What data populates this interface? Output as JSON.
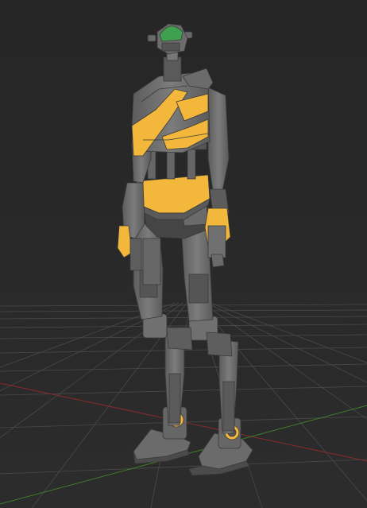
{
  "viewport": {
    "name": "3d-viewport",
    "background": "#282828"
  },
  "scene": {
    "model": "humanoid-robot",
    "colors": {
      "body_gray": "#6e6e6e",
      "body_dark": "#4d4d4d",
      "body_light": "#8a8a8a",
      "accent_yellow": "#f2b73b",
      "head_green": "#3fa14f",
      "grid_line": "#4a4a4a",
      "axis_x": "#8a2b2b",
      "axis_y": "#3f7d2a"
    }
  }
}
